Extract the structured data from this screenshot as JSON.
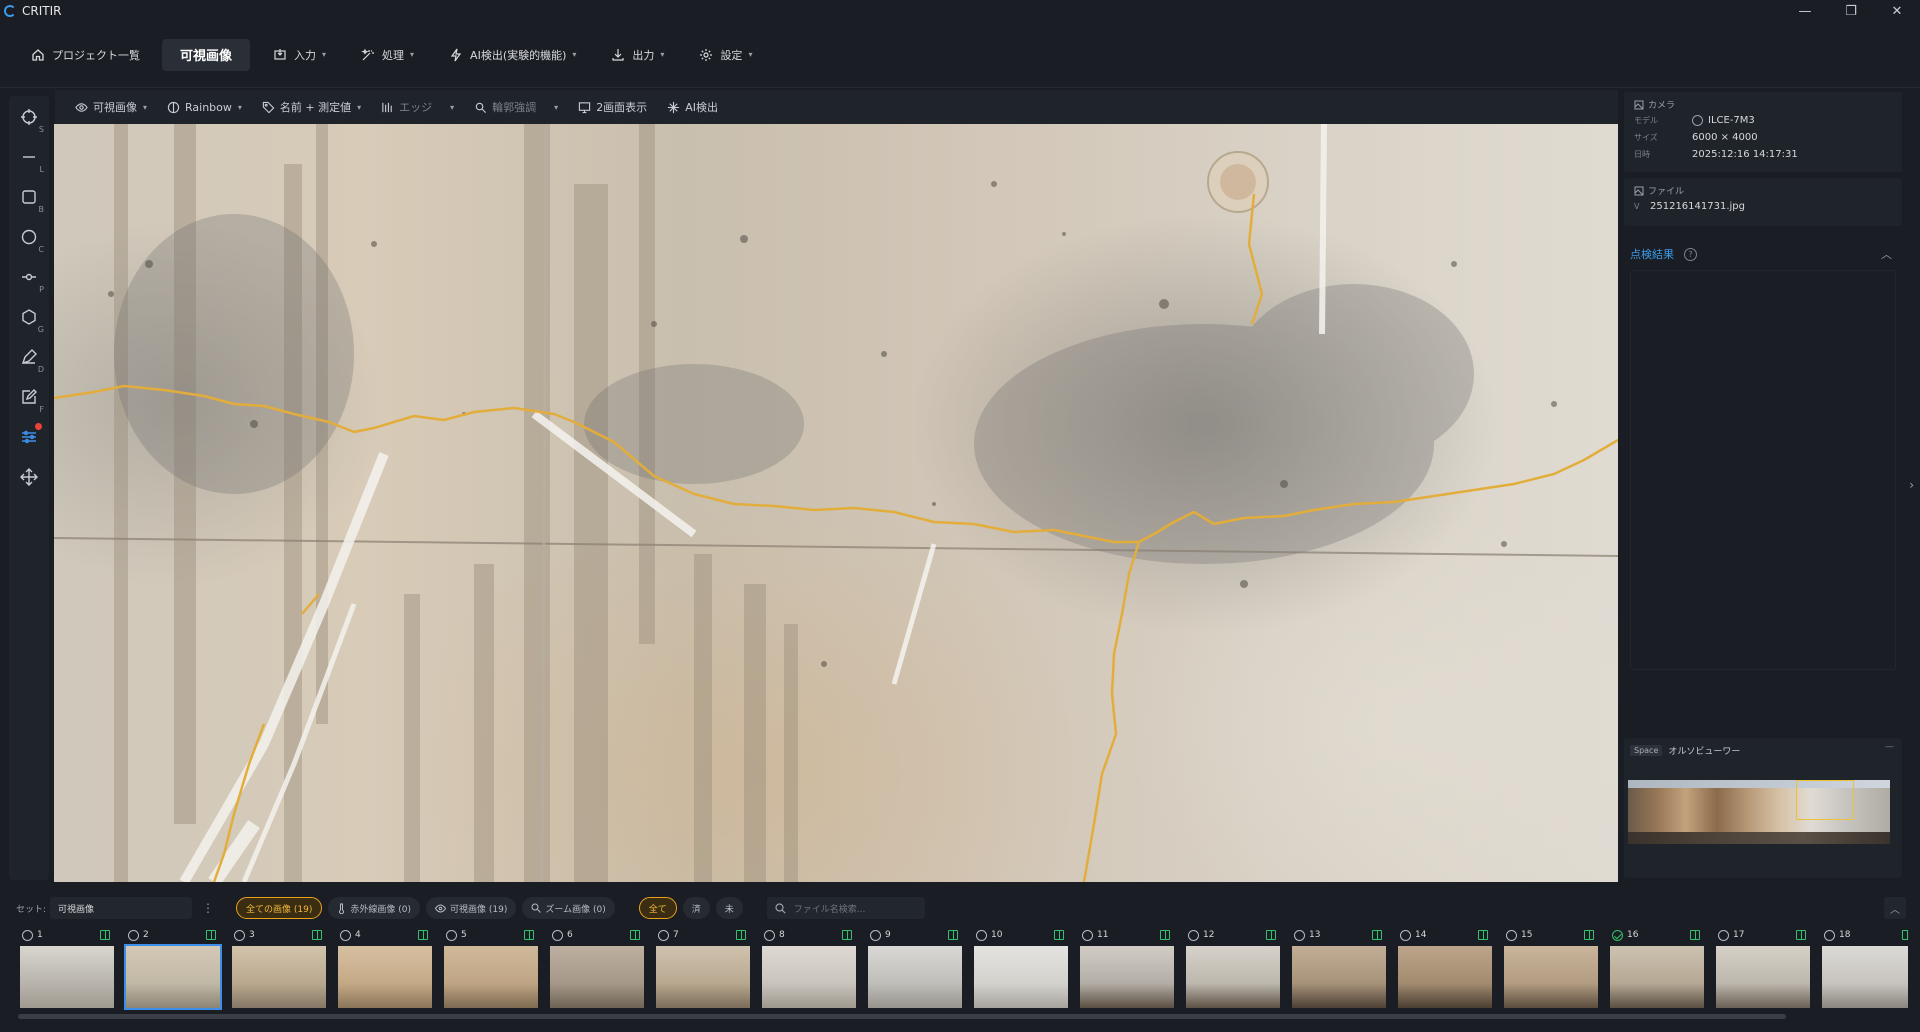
{
  "app": {
    "title": "CRITIR"
  },
  "window_controls": {
    "minimize": "—",
    "maximize": "❐",
    "close": "✕"
  },
  "menu": [
    {
      "label": "プロジェクト一覧",
      "icon": "home-icon"
    },
    {
      "label": "可視画像",
      "icon": "",
      "active": true
    },
    {
      "label": "入力",
      "icon": "import-icon",
      "caret": "▾"
    },
    {
      "label": "処理",
      "icon": "magic-icon",
      "caret": "▾"
    },
    {
      "label": "AI検出(実験的機能)",
      "icon": "ai-bolt-icon",
      "caret": "▾"
    },
    {
      "label": "出力",
      "icon": "download-icon",
      "caret": "▾"
    },
    {
      "label": "設定",
      "icon": "gear-icon",
      "caret": "▾"
    }
  ],
  "left_tools": [
    {
      "name": "select",
      "key": "S"
    },
    {
      "name": "line",
      "key": "L"
    },
    {
      "name": "box",
      "key": "B"
    },
    {
      "name": "circle",
      "key": "C"
    },
    {
      "name": "point",
      "key": "P"
    },
    {
      "name": "polygon",
      "key": "G"
    },
    {
      "name": "draw",
      "key": "D"
    },
    {
      "name": "edit",
      "key": "F"
    },
    {
      "name": "adjust",
      "key": "",
      "active": true,
      "badge": true
    },
    {
      "name": "move",
      "key": ""
    }
  ],
  "image_toolbar": [
    {
      "label": "可視画像",
      "caret": "▾"
    },
    {
      "label": "Rainbow",
      "caret": "▾"
    },
    {
      "label": "名前 + 測定値",
      "caret": "▾"
    },
    {
      "label": "エッジ",
      "caret": "▾",
      "dim": true
    },
    {
      "label": "輪郭強調",
      "caret": "▾",
      "dim": true
    },
    {
      "label": "2画面表示",
      "caret": ""
    },
    {
      "label": "AI検出",
      "caret": ""
    }
  ],
  "camera": {
    "header": "カメラ",
    "model_label": "モデル",
    "model": "ILCE-7M3",
    "size_label": "サイズ",
    "size": "6000 × 4000",
    "date_label": "日時",
    "date": "2025:12:16 14:17:31"
  },
  "file": {
    "header": "ファイル",
    "prefix": "V",
    "name": "251216141731.jpg"
  },
  "inspection": {
    "title": "点検結果",
    "help": "?",
    "collapse": "︿"
  },
  "ortho": {
    "key": "Space",
    "label": "オルソビューワー",
    "minimize": "—",
    "expand": "›"
  },
  "filters": {
    "set_label": "セット:",
    "set_value": "可視画像",
    "kebab": "⋮",
    "chips": [
      {
        "label": "全ての画像 (19)",
        "on": true
      },
      {
        "label": "赤外線画像 (0)"
      },
      {
        "label": "可視画像 (19)"
      },
      {
        "label": "ズーム画像 (0)"
      }
    ],
    "status_chips": [
      {
        "label": "全て",
        "on": true
      },
      {
        "label": "済"
      },
      {
        "label": "未"
      }
    ],
    "search_placeholder": "ファイル名検索...",
    "collapse": "︿"
  },
  "thumbnails": [
    {
      "n": "1",
      "checked": false,
      "tone": [
        "#b8b4ac",
        "#d9d6cf",
        "#a09a90"
      ]
    },
    {
      "n": "2",
      "checked": false,
      "selected": true,
      "tone": [
        "#c2b8a6",
        "#d4c8b6",
        "#8d8476"
      ]
    },
    {
      "n": "3",
      "checked": false,
      "tone": [
        "#b9a88e",
        "#d2c3ac",
        "#857766"
      ]
    },
    {
      "n": "4",
      "checked": false,
      "tone": [
        "#c4a986",
        "#d6c0a2",
        "#8b7559"
      ]
    },
    {
      "n": "5",
      "checked": false,
      "tone": [
        "#bfa584",
        "#cfb99a",
        "#7d6a52"
      ]
    },
    {
      "n": "6",
      "checked": false,
      "tone": [
        "#a59888",
        "#bdb0a0",
        "#6e6355"
      ]
    },
    {
      "n": "7",
      "checked": false,
      "tone": [
        "#b8a890",
        "#cfc2ae",
        "#7a6c5a"
      ]
    },
    {
      "n": "8",
      "checked": false,
      "tone": [
        "#c9c4bc",
        "#dedad3",
        "#9e988f"
      ]
    },
    {
      "n": "9",
      "checked": false,
      "tone": [
        "#c0beb9",
        "#d9d8d4",
        "#97948e"
      ]
    },
    {
      "n": "10",
      "checked": false,
      "tone": [
        "#d4d2cd",
        "#e4e3df",
        "#a7a49d"
      ]
    },
    {
      "n": "11",
      "checked": false,
      "tone": [
        "#b3aea5",
        "#d1cdc5",
        "#5b4f43"
      ]
    },
    {
      "n": "12",
      "checked": false,
      "tone": [
        "#bdb8ae",
        "#d6d2ca",
        "#5e5246"
      ]
    },
    {
      "n": "13",
      "checked": false,
      "tone": [
        "#a8927a",
        "#c2ae96",
        "#4c4034"
      ]
    },
    {
      "n": "14",
      "checked": false,
      "tone": [
        "#a38b70",
        "#bca58a",
        "#4a3e31"
      ]
    },
    {
      "n": "15",
      "checked": false,
      "tone": [
        "#b39d82",
        "#c9b59c",
        "#5a4c3d"
      ]
    },
    {
      "n": "16",
      "checked": true,
      "tone": [
        "#b5a894",
        "#cdc2b1",
        "#5a4f42"
      ]
    },
    {
      "n": "17",
      "checked": false,
      "tone": [
        "#bdb7ad",
        "#d6d1c8",
        "#6a6055"
      ]
    },
    {
      "n": "18",
      "checked": false,
      "tone": [
        "#c7c4bf",
        "#dcdad6",
        "#8a857d"
      ]
    }
  ],
  "colors": {
    "accent": "#3b8fe8",
    "crack": "#e8b23a",
    "active_chip": "#e8a21c",
    "success": "#35c16b"
  }
}
